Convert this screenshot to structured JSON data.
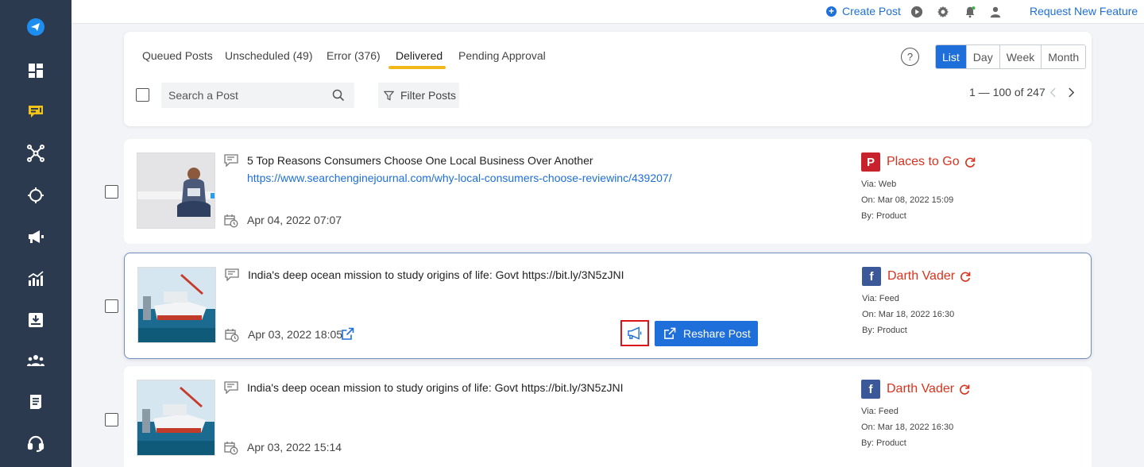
{
  "topbar": {
    "create_post_label": "Create Post",
    "request_feature_label": "Request New Feature"
  },
  "tabs": [
    {
      "label": "Queued Posts"
    },
    {
      "label": "Unscheduled (49)"
    },
    {
      "label": "Error (376)"
    },
    {
      "label": "Delivered",
      "active": true
    },
    {
      "label": "Pending Approval"
    }
  ],
  "view_modes": [
    {
      "label": "List",
      "active": true
    },
    {
      "label": "Day"
    },
    {
      "label": "Week"
    },
    {
      "label": "Month"
    }
  ],
  "help_label": "?",
  "search": {
    "placeholder": "Search a Post"
  },
  "filter_label": "Filter Posts",
  "pagination": {
    "text": "1 — 100 of 247"
  },
  "posts": [
    {
      "title": "5 Top Reasons Consumers Choose One Local Business Over Another",
      "link": "https://www.searchenginejournal.com/why-local-consumers-choose-reviewinc/439207/",
      "date": "Apr 04, 2022 07:07",
      "network": "pinterest",
      "account": "Places to Go",
      "via": "Via: Web",
      "on": "On: Mar 08, 2022 15:09",
      "by": "By: Product"
    },
    {
      "title": "India's deep ocean mission to study origins of life: Govt https://bit.ly/3N5zJNI",
      "date": "Apr 03, 2022 18:05",
      "network": "facebook",
      "account": "Darth Vader",
      "via": "Via: Feed",
      "on": "On: Mar 18, 2022 16:30",
      "by": "By: Product",
      "reshare_label": "Reshare Post"
    },
    {
      "title": "India's deep ocean mission to study origins of life: Govt https://bit.ly/3N5zJNI",
      "date": "Apr 03, 2022 15:14",
      "network": "facebook",
      "account": "Darth Vader",
      "via": "Via: Feed",
      "on": "On: Mar 18, 2022 16:30",
      "by": "By: Product"
    }
  ],
  "colors": {
    "sidebar": "#2b3a4e",
    "accent": "#1e6fd9",
    "tab_underline": "#f2b71b",
    "account_red": "#d8331e",
    "pinterest": "#c8232c",
    "facebook": "#3b5998",
    "active_nav": "#f2c318"
  }
}
